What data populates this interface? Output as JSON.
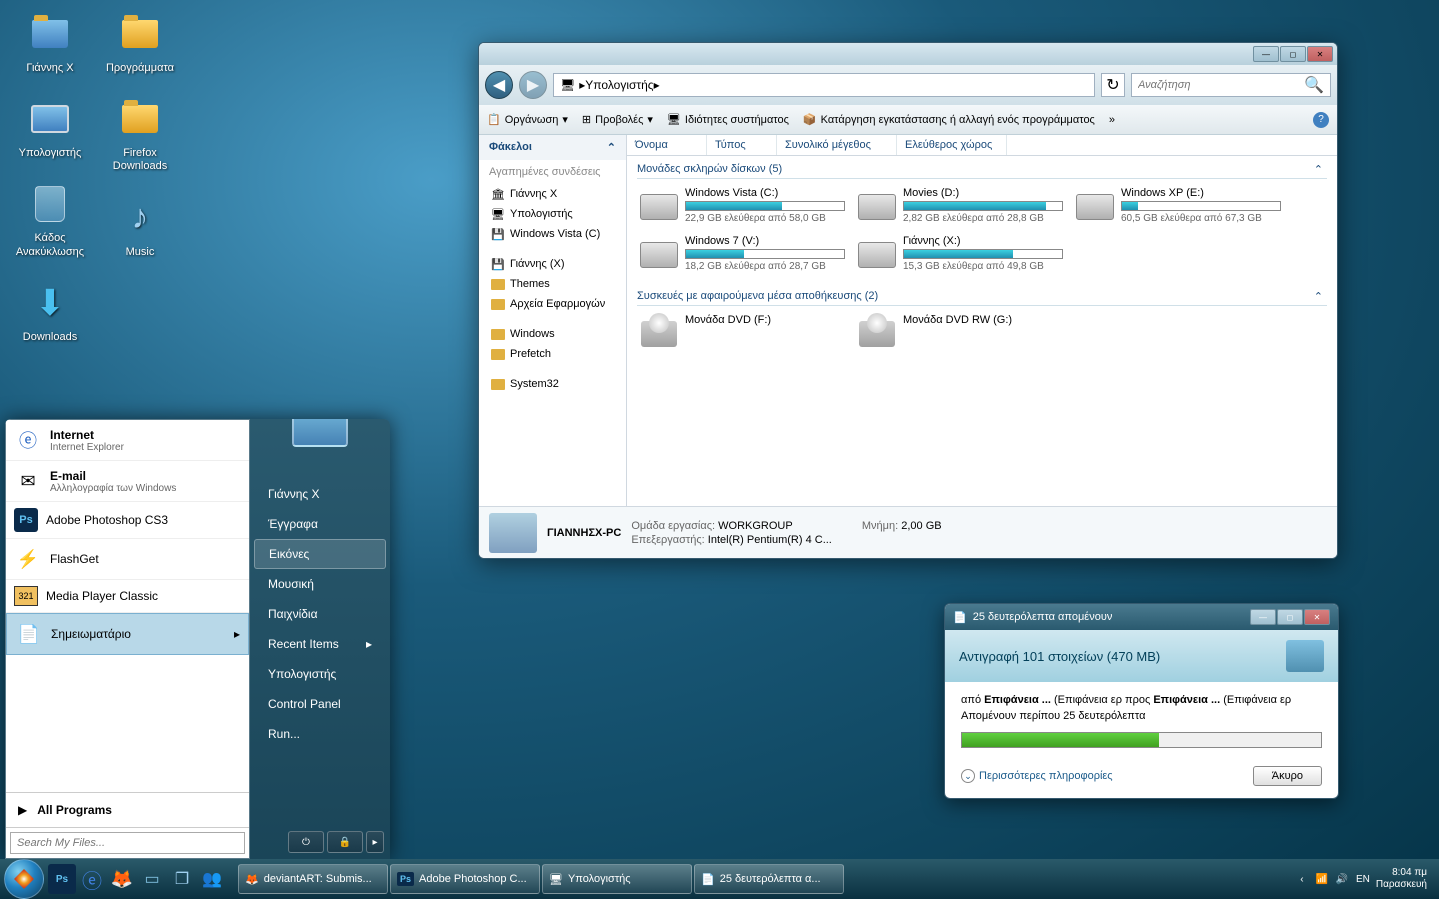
{
  "desktop": {
    "icons_col1": [
      {
        "label": "Γιάννης Χ",
        "type": "folder-user"
      },
      {
        "label": "Υπολογιστής",
        "type": "computer"
      },
      {
        "label": "Κάδος Ανακύκλωσης",
        "type": "bin"
      },
      {
        "label": "Downloads",
        "type": "download"
      }
    ],
    "icons_col2": [
      {
        "label": "Προγράμματα",
        "type": "folder"
      },
      {
        "label": "Firefox Downloads",
        "type": "folder"
      },
      {
        "label": "Music",
        "type": "music"
      }
    ]
  },
  "start_menu": {
    "left": [
      {
        "title": "Internet",
        "subtitle": "Internet Explorer",
        "icon": "ie"
      },
      {
        "title": "E-mail",
        "subtitle": "Αλληλογραφία των Windows",
        "icon": "mail"
      },
      {
        "title": "Adobe Photoshop CS3",
        "icon": "ps"
      },
      {
        "title": "FlashGet",
        "icon": "flashget"
      },
      {
        "title": "Media Player Classic",
        "icon": "mpc"
      },
      {
        "title": "Σημειωματάριο",
        "icon": "notepad",
        "selected": true
      }
    ],
    "all_programs": "All Programs",
    "search_placeholder": "Search My Files...",
    "right": [
      "Γιάννης Χ",
      "Έγγραφα",
      "Εικόνες",
      "Μουσική",
      "Παιχνίδια",
      "Recent Items",
      "Υπολογιστής",
      "Control Panel",
      "Run..."
    ],
    "right_highlight_index": 2
  },
  "explorer": {
    "breadcrumb": "Υπολογιστής",
    "search_placeholder": "Αναζήτηση",
    "toolbar": [
      "Οργάνωση",
      "Προβολές",
      "Ιδιότητες συστήματος",
      "Κατάργηση εγκατάστασης ή αλλαγή ενός προγράμματος"
    ],
    "sidebar_header": "Φάκελοι",
    "sidebar_fav_title": "Αγαπημένες συνδέσεις",
    "sidebar_favs": [
      "Γιάννης Χ",
      "Υπολογιστής",
      "Windows Vista (C)"
    ],
    "sidebar_folders": [
      "Γιάννης (X)",
      "Themes",
      "Αρχεία Εφαρμογών",
      "Windows",
      "Prefetch",
      "System32"
    ],
    "columns": [
      "Όνομα",
      "Τύπος",
      "Συνολικό μέγεθος",
      "Ελεύθερος χώρος"
    ],
    "group1_title": "Μονάδες σκληρών δίσκων (5)",
    "drives": [
      {
        "name": "Windows Vista (C:)",
        "free": "22,9 GB ελεύθερα από 58,0 GB",
        "fill": 61
      },
      {
        "name": "Movies (D:)",
        "free": "2,82 GB ελεύθερα από 28,8 GB",
        "fill": 90
      },
      {
        "name": "Windows XP (E:)",
        "free": "60,5 GB ελεύθερα από 67,3 GB",
        "fill": 10
      },
      {
        "name": "Windows 7 (V:)",
        "free": "18,2 GB ελεύθερα από 28,7 GB",
        "fill": 37
      },
      {
        "name": "Γιάννης (X:)",
        "free": "15,3 GB ελεύθερα από 49,8 GB",
        "fill": 69
      }
    ],
    "group2_title": "Συσκευές με αφαιρούμενα μέσα αποθήκευσης (2)",
    "removable": [
      {
        "name": "Μονάδα DVD (F:)"
      },
      {
        "name": "Μονάδα DVD RW (G:)"
      }
    ],
    "details": {
      "name": "ΓΙΑΝΝΗΣΧ-PC",
      "workgroup_label": "Ομάδα εργασίας:",
      "workgroup": "WORKGROUP",
      "cpu_label": "Επεξεργαστής:",
      "cpu": "Intel(R) Pentium(R) 4 C...",
      "mem_label": "Μνήμη:",
      "mem": "2,00 GB"
    }
  },
  "copy_dialog": {
    "title": "25 δευτερόλεπτα απομένουν",
    "header": "Αντιγραφή 101 στοιχείων (470 MB)",
    "line1_pre": "από ",
    "line1_b1": "Επιφάνεια ...",
    "line1_mid": " (Επιφάνεια ερ προς ",
    "line1_b2": "Επιφάνεια ...",
    "line1_end": " (Επιφάνεια ερ",
    "line2": "Απομένουν περίπου 25 δευτερόλεπτα",
    "more": "Περισσότερες πληροφορίες",
    "cancel": "Άκυρο",
    "progress": 55
  },
  "taskbar": {
    "tasks": [
      {
        "label": "deviantART: Submis...",
        "icon": "ff"
      },
      {
        "label": "Adobe Photoshop C...",
        "icon": "ps"
      },
      {
        "label": "Υπολογιστής",
        "icon": "explorer"
      },
      {
        "label": "25 δευτερόλεπτα α...",
        "icon": "copy"
      }
    ],
    "lang": "EN",
    "time": "8:04 πμ",
    "day": "Παρασκευή"
  }
}
